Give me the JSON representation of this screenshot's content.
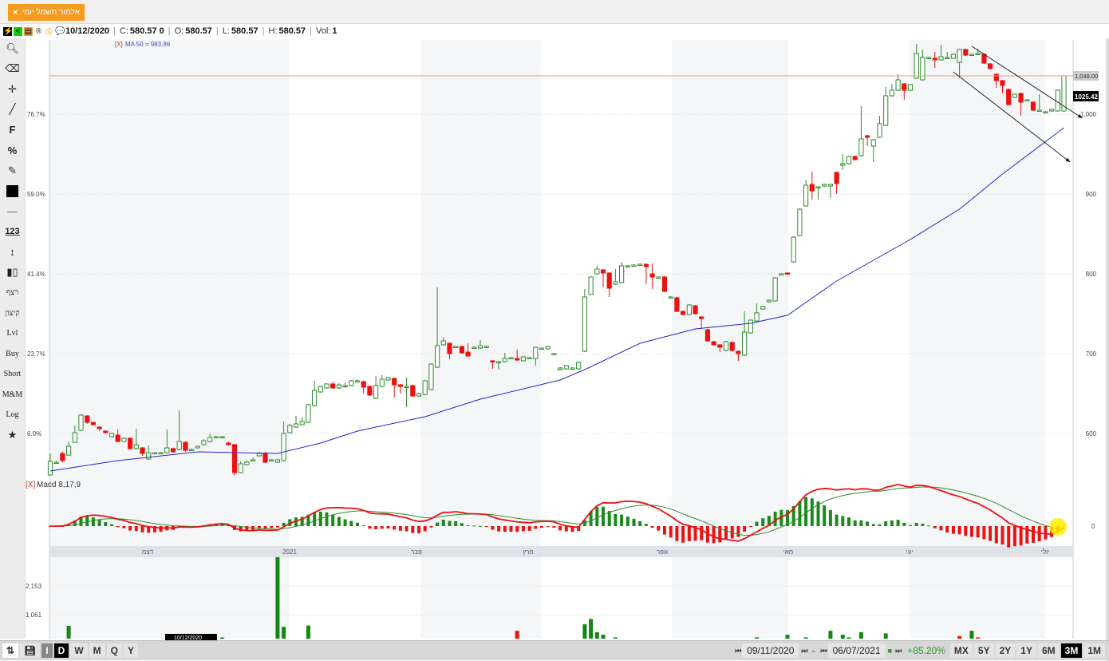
{
  "tab": {
    "title": "אלמור חשמל יומי",
    "close": "×"
  },
  "info": {
    "date": "10/12/2020",
    "c_label": "C:",
    "c": "580.57 0",
    "o_label": "O:",
    "o": "580.57",
    "l_label": "L:",
    "l": "580.57",
    "h_label": "H:",
    "h": "580.57",
    "vol_label": "Vol:",
    "vol": "1",
    "icons": [
      "lightning-icon",
      "share-icon",
      "report-icon",
      "registered-icon",
      "target-icon",
      "comment-icon"
    ]
  },
  "left_toolbar": [
    "search",
    "eraser",
    "crosshair",
    "line",
    "F",
    "%",
    "edit",
    "color",
    "dash",
    "123",
    "vertical-measure",
    "candle",
    "רצף",
    "קיצון",
    "Lvl",
    "Buy",
    "Short",
    "M&M",
    "Log",
    "star"
  ],
  "left_toolbar_text": {
    "f": "F",
    "pct": "%",
    "num": "123",
    "seq": "רצף",
    "ext": "קיצון",
    "lvl": "Lvl",
    "buy": "Buy",
    "short": "Short",
    "mm": "M&M",
    "log": "Log"
  },
  "indicators": {
    "ma_remove": "[X]",
    "ma_label": "MA 50 = 983.86",
    "macd_remove": "[X]",
    "macd_label": "Macd 8,17,9"
  },
  "axis": {
    "price_ticks": [
      "1,000",
      "900",
      "800",
      "700",
      "600"
    ],
    "price_tick_values": [
      1000,
      900,
      800,
      700,
      600
    ],
    "pct_ticks": [
      "76.7%",
      "59.0%",
      "41.4%",
      "23.7%",
      "6.0%"
    ],
    "last_price_tag": "1025.42",
    "hline_tag": "1,048.00",
    "macd_zero": "0",
    "volume_ticks": [
      "2,153",
      "1,061"
    ],
    "volume_tick_values": [
      2153,
      1061
    ],
    "months": [
      "דצמ",
      "2021",
      "פבר",
      "מרץ",
      "אפר",
      "מאי",
      "יוני",
      "יולי"
    ],
    "crosshair_date": "10/12/2020"
  },
  "colors": {
    "up": "#2e8b2e",
    "down": "#ee1111",
    "ma": "#2323cc",
    "hline": "#e8a070",
    "macd": "#ee1111",
    "signal": "#2e8b2e",
    "accent": "#f39c1f"
  },
  "chart_data": {
    "type": "candlestick",
    "ylim": [
      548,
      1092
    ],
    "candles": [
      [
        548,
        575,
        548,
        565
      ],
      [
        564,
        566,
        562,
        564
      ],
      [
        575,
        577,
        564,
        566
      ],
      [
        573,
        590,
        572,
        584
      ],
      [
        589,
        610,
        588,
        601
      ],
      [
        604,
        624,
        603,
        623
      ],
      [
        622,
        623,
        612,
        614
      ],
      [
        614,
        615,
        610,
        611
      ],
      [
        608,
        609,
        603,
        606
      ],
      [
        603,
        604,
        600,
        601
      ],
      [
        596,
        601,
        595,
        600
      ],
      [
        598,
        605,
        589,
        590
      ],
      [
        590,
        595,
        589,
        594
      ],
      [
        594,
        595,
        580,
        581
      ],
      [
        581,
        606,
        580,
        586
      ],
      [
        582,
        583,
        572,
        575
      ],
      [
        568,
        585,
        567,
        576
      ],
      [
        576,
        577,
        575,
        576
      ],
      [
        576,
        577,
        575,
        576
      ],
      [
        576,
        605,
        575,
        582
      ],
      [
        581,
        582,
        576,
        577
      ],
      [
        580,
        629,
        579,
        590
      ],
      [
        589,
        590,
        577,
        579
      ],
      [
        580,
        581,
        579,
        580
      ],
      [
        582,
        585,
        581,
        584
      ],
      [
        586,
        593,
        585,
        591
      ],
      [
        590,
        600,
        589,
        595
      ],
      [
        596,
        597,
        595,
        596
      ],
      [
        596,
        597,
        595,
        596
      ],
      [
        588,
        590,
        585,
        586
      ],
      [
        586,
        587,
        548,
        551
      ],
      [
        551,
        565,
        550,
        562
      ],
      [
        561,
        566,
        560,
        564
      ],
      [
        566,
        570,
        565,
        567
      ],
      [
        572,
        577,
        571,
        575
      ],
      [
        575,
        577,
        563,
        564
      ],
      [
        566,
        568,
        565,
        567
      ],
      [
        564,
        568,
        563,
        567
      ],
      [
        566,
        615,
        565,
        600
      ],
      [
        601,
        612,
        600,
        610
      ],
      [
        608,
        622,
        607,
        612
      ],
      [
        611,
        620,
        610,
        615
      ],
      [
        614,
        637,
        613,
        636
      ],
      [
        635,
        666,
        634,
        654
      ],
      [
        652,
        660,
        651,
        659
      ],
      [
        657,
        663,
        656,
        662
      ],
      [
        662,
        665,
        656,
        657
      ],
      [
        657,
        663,
        656,
        661
      ],
      [
        660,
        664,
        657,
        660
      ],
      [
        660,
        667,
        659,
        666
      ],
      [
        666,
        668,
        664,
        666
      ],
      [
        665,
        666,
        650,
        658
      ],
      [
        659,
        660,
        647,
        648
      ],
      [
        644,
        672,
        643,
        660
      ],
      [
        659,
        673,
        658,
        668
      ],
      [
        667,
        671,
        666,
        670
      ],
      [
        669,
        670,
        645,
        661
      ],
      [
        661,
        662,
        650,
        659
      ],
      [
        659,
        670,
        633,
        659
      ],
      [
        660,
        661,
        646,
        647
      ],
      [
        647,
        651,
        646,
        650
      ],
      [
        649,
        667,
        648,
        666
      ],
      [
        655,
        688,
        654,
        687
      ],
      [
        683,
        783,
        682,
        710
      ],
      [
        711,
        721,
        710,
        716
      ],
      [
        713,
        714,
        693,
        700
      ],
      [
        709,
        710,
        708,
        709
      ],
      [
        709,
        710,
        700,
        701
      ],
      [
        702,
        713,
        697,
        697
      ],
      [
        708,
        709,
        707,
        708
      ],
      [
        707,
        717,
        706,
        710
      ],
      [
        709,
        710,
        708,
        709
      ],
      [
        691,
        692,
        681,
        690
      ],
      [
        690,
        691,
        680,
        690
      ],
      [
        690,
        701,
        689,
        694
      ],
      [
        695,
        696,
        694,
        695
      ],
      [
        694,
        705,
        691,
        692
      ],
      [
        691,
        697,
        690,
        696
      ],
      [
        695,
        696,
        694,
        695
      ],
      [
        694,
        709,
        685,
        708
      ],
      [
        707,
        708,
        706,
        707
      ],
      [
        706,
        710,
        705,
        709
      ],
      [
        700,
        701,
        699,
        700
      ],
      [
        680,
        683,
        679,
        682
      ],
      [
        681,
        686,
        680,
        685
      ],
      [
        682,
        683,
        681,
        682
      ],
      [
        681,
        690,
        680,
        689
      ],
      [
        703,
        781,
        702,
        771
      ],
      [
        774,
        797,
        773,
        796
      ],
      [
        800,
        810,
        799,
        806
      ],
      [
        805,
        806,
        783,
        801
      ],
      [
        801,
        802,
        771,
        782
      ],
      [
        787,
        806,
        786,
        790
      ],
      [
        789,
        815,
        788,
        810
      ],
      [
        810,
        811,
        809,
        810
      ],
      [
        811,
        812,
        810,
        811
      ],
      [
        812,
        813,
        811,
        812
      ],
      [
        812,
        813,
        787,
        809
      ],
      [
        800,
        813,
        781,
        796
      ],
      [
        796,
        797,
        795,
        796
      ],
      [
        796,
        797,
        777,
        778
      ],
      [
        771,
        772,
        770,
        771
      ],
      [
        770,
        771,
        752,
        753
      ],
      [
        753,
        754,
        748,
        749
      ],
      [
        749,
        762,
        748,
        761
      ],
      [
        760,
        761,
        749,
        750
      ],
      [
        746,
        747,
        731,
        744
      ],
      [
        730,
        731,
        715,
        716
      ],
      [
        715,
        716,
        710,
        711
      ],
      [
        711,
        712,
        702,
        708
      ],
      [
        704,
        716,
        703,
        715
      ],
      [
        714,
        715,
        703,
        704
      ],
      [
        703,
        704,
        691,
        700
      ],
      [
        698,
        753,
        697,
        727
      ],
      [
        726,
        743,
        725,
        742
      ],
      [
        741,
        763,
        740,
        751
      ],
      [
        756,
        760,
        755,
        759
      ],
      [
        765,
        768,
        764,
        767
      ],
      [
        766,
        796,
        765,
        795
      ],
      [
        800,
        801,
        799,
        800
      ],
      [
        801,
        802,
        799,
        800
      ],
      [
        815,
        847,
        814,
        846
      ],
      [
        848,
        882,
        847,
        881
      ],
      [
        885,
        918,
        884,
        911
      ],
      [
        912,
        928,
        893,
        904
      ],
      [
        909,
        910,
        893,
        909
      ],
      [
        910,
        913,
        909,
        912
      ],
      [
        910,
        913,
        895,
        912
      ],
      [
        927,
        928,
        900,
        913
      ],
      [
        936,
        950,
        930,
        938
      ],
      [
        938,
        948,
        937,
        947
      ],
      [
        947,
        948,
        942,
        943
      ],
      [
        948,
        1010,
        947,
        969
      ],
      [
        973,
        974,
        960,
        971
      ],
      [
        960,
        969,
        940,
        968
      ],
      [
        971,
        998,
        970,
        988
      ],
      [
        986,
        1034,
        985,
        1023
      ],
      [
        1023,
        1038,
        1022,
        1030
      ],
      [
        1030,
        1050,
        1029,
        1043
      ],
      [
        1038,
        1039,
        1018,
        1030
      ],
      [
        1030,
        1038,
        1029,
        1037
      ],
      [
        1045,
        1088,
        1044,
        1076
      ],
      [
        1043,
        1081,
        1042,
        1071
      ],
      [
        1071,
        1072,
        1070,
        1071
      ],
      [
        1070,
        1078,
        1058,
        1068
      ],
      [
        1068,
        1087,
        1067,
        1072
      ],
      [
        1071,
        1078,
        1070,
        1071
      ],
      [
        1070,
        1076,
        1069,
        1075
      ],
      [
        1065,
        1082,
        1045,
        1081
      ],
      [
        1081,
        1082,
        1073,
        1074
      ],
      [
        1075,
        1076,
        1074,
        1075
      ],
      [
        1076,
        1082,
        1075,
        1076
      ],
      [
        1075,
        1076,
        1063,
        1064
      ],
      [
        1063,
        1064,
        1056,
        1057
      ],
      [
        1050,
        1051,
        1033,
        1042
      ],
      [
        1042,
        1043,
        1026,
        1036
      ],
      [
        1031,
        1032,
        1011,
        1012
      ],
      [
        1021,
        1026,
        1020,
        1025
      ],
      [
        1026,
        1027,
        998,
        1015
      ],
      [
        1018,
        1019,
        1017,
        1018
      ],
      [
        1015,
        1016,
        1004,
        1005
      ],
      [
        1005,
        1025,
        1004,
        1005
      ],
      [
        1003,
        1004,
        1002,
        1003
      ],
      [
        1004,
        1007,
        1003,
        1006
      ],
      [
        1004,
        1031,
        1003,
        1030
      ],
      [
        1004,
        1049,
        1003,
        1048
      ]
    ],
    "ma50": [
      [
        0,
        553
      ],
      [
        11,
        566
      ],
      [
        24,
        577
      ],
      [
        37,
        575
      ],
      [
        44,
        588
      ],
      [
        50,
        603
      ],
      [
        61,
        621
      ],
      [
        70,
        643
      ],
      [
        83,
        667
      ],
      [
        87,
        680
      ],
      [
        96,
        713
      ],
      [
        105,
        731
      ],
      [
        114,
        738
      ],
      [
        120,
        748
      ],
      [
        128,
        791
      ],
      [
        140,
        843
      ],
      [
        148,
        881
      ],
      [
        155,
        925
      ],
      [
        165,
        983
      ]
    ],
    "hline_value": 1048.0,
    "trendlines": [
      [
        [
          150,
          1085
        ],
        [
          168,
          995
        ]
      ],
      [
        [
          147,
          1053
        ],
        [
          166,
          940
        ]
      ]
    ],
    "volume": [
      [
        3,
        640,
        "up"
      ],
      [
        11,
        150,
        "down"
      ],
      [
        14,
        80,
        "up"
      ],
      [
        23,
        100,
        "up"
      ],
      [
        28,
        200,
        "up"
      ],
      [
        31,
        100,
        "up"
      ],
      [
        35,
        50,
        "down"
      ],
      [
        37,
        3270,
        "up"
      ],
      [
        38,
        600,
        "up"
      ],
      [
        42,
        650,
        "up"
      ],
      [
        43,
        100,
        "up"
      ],
      [
        63,
        150,
        "up"
      ],
      [
        64,
        100,
        "up"
      ],
      [
        76,
        450,
        "down"
      ],
      [
        78,
        150,
        "up"
      ],
      [
        87,
        700,
        "up"
      ],
      [
        88,
        900,
        "up"
      ],
      [
        89,
        400,
        "up"
      ],
      [
        90,
        300,
        "up"
      ],
      [
        92,
        200,
        "up"
      ],
      [
        93,
        150,
        "up"
      ],
      [
        108,
        100,
        "down"
      ],
      [
        115,
        200,
        "up"
      ],
      [
        120,
        300,
        "up"
      ],
      [
        123,
        200,
        "up"
      ],
      [
        127,
        450,
        "up"
      ],
      [
        129,
        300,
        "up"
      ],
      [
        130,
        200,
        "up"
      ],
      [
        132,
        400,
        "up"
      ],
      [
        136,
        350,
        "up"
      ],
      [
        140,
        150,
        "up"
      ],
      [
        148,
        250,
        "down"
      ],
      [
        150,
        450,
        "up"
      ],
      [
        151,
        200,
        "down"
      ],
      [
        155,
        100,
        "down"
      ]
    ]
  },
  "bottom": {
    "interval_buttons": [
      "I",
      "D",
      "W",
      "M",
      "Q",
      "Y"
    ],
    "active_interval": "D",
    "start_date": "09/11/2020",
    "end_date": "06/07/2021",
    "dash": "-",
    "change": "+85.20%",
    "range_buttons": [
      "MX",
      "5Y",
      "2Y",
      "1Y",
      "6M",
      "3M",
      "1M"
    ],
    "active_range": "3M",
    "nav_first": "⏮",
    "nav_prev": "◀",
    "nav_next": "▶",
    "nav_last": "⏭",
    "lock": "🔒"
  }
}
